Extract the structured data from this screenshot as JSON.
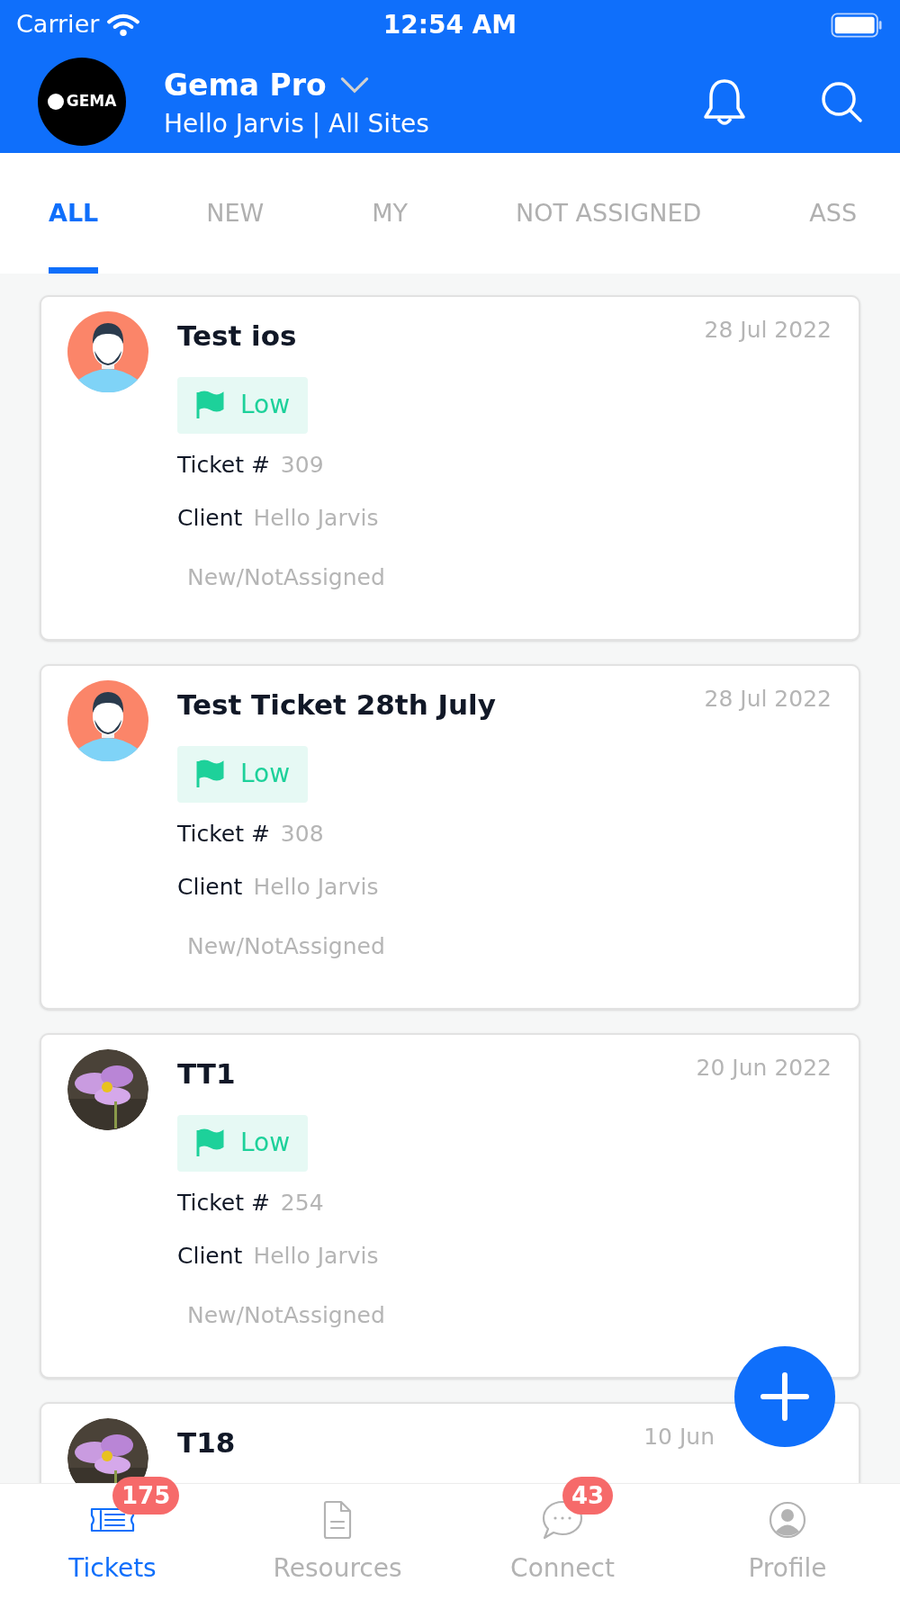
{
  "status_bar": {
    "carrier": "Carrier",
    "time": "12:54 AM"
  },
  "header": {
    "logo_text": "GEMA",
    "title": "Gema Pro",
    "subtitle": "Hello Jarvis | All Sites"
  },
  "tabs": [
    {
      "label": "ALL",
      "selected": true
    },
    {
      "label": "NEW",
      "selected": false
    },
    {
      "label": "MY",
      "selected": false
    },
    {
      "label": "NOT ASSIGNED",
      "selected": false
    },
    {
      "label": "ASS",
      "selected": false
    }
  ],
  "tickets": [
    {
      "title": "Test ios",
      "date": "28 Jul 2022",
      "avatar": {
        "kind": "illustration"
      },
      "priority": "Low",
      "ticket_label": "Ticket #",
      "ticket_number": "309",
      "client_label": "Client",
      "client": "Hello Jarvis",
      "status": "New/NotAssigned"
    },
    {
      "title": "Test Ticket 28th July",
      "date": "28 Jul 2022",
      "avatar": {
        "kind": "illustration"
      },
      "priority": "Low",
      "ticket_label": "Ticket #",
      "ticket_number": "308",
      "client_label": "Client",
      "client": "Hello Jarvis",
      "status": "New/NotAssigned"
    },
    {
      "title": "TT1",
      "date": "20 Jun 2022",
      "priority": "Low",
      "ticket_label": "Ticket #",
      "ticket_number": "254",
      "client_label": "Client",
      "client": "Hello Jarvis",
      "status": "New/NotAssigned"
    },
    {
      "title": "T18",
      "date": "10 Jun"
    }
  ],
  "bottom_nav": [
    {
      "label": "Tickets",
      "kind": "ticket",
      "badge": "175",
      "selected": true
    },
    {
      "label": "Resources",
      "kind": "document",
      "selected": false
    },
    {
      "label": "Connect",
      "kind": "chat",
      "badge": "43",
      "selected": false
    },
    {
      "label": "Profile",
      "kind": "user",
      "selected": false
    }
  ]
}
